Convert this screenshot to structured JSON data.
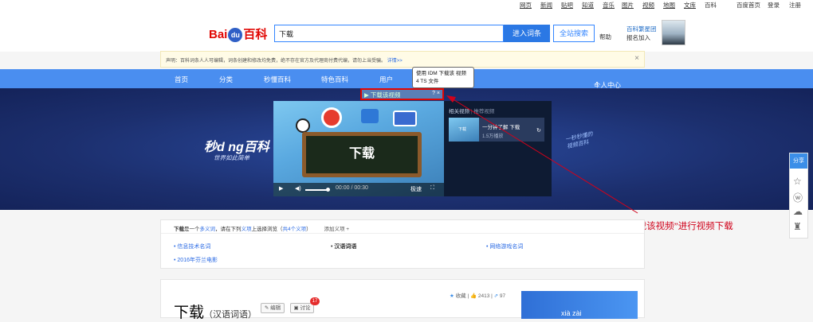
{
  "topnav": {
    "items": [
      "网页",
      "新闻",
      "贴吧",
      "知道",
      "音乐",
      "图片",
      "视频",
      "地图",
      "文库",
      "百科",
      "百度首页",
      "登录",
      "注册"
    ]
  },
  "header": {
    "logo_left": "Bai",
    "logo_paw": "du",
    "logo_right": "百科",
    "search_value": "下载",
    "enter_label": "进入词条",
    "fulltext_label": "全站搜索",
    "help_label": "帮助",
    "star_line1": "百科繁星团",
    "star_line2": "报名加入"
  },
  "notice": {
    "text": "声明：百科词条人人可编辑，词条创建和修改均免费，绝不存在官方及代理商付费代编，请勿上当受骗。",
    "link": "详情>>",
    "close": "×"
  },
  "mainnav": {
    "items": [
      "首页",
      "分类",
      "秒懂百科",
      "特色百科",
      "用户"
    ],
    "personal": "个人中心"
  },
  "banner": {
    "logo": "秒d ng百科",
    "slogan": "世界如此简单",
    "hand_note_1": "一秒秒懂的",
    "hand_note_2": "视频百科"
  },
  "download_bar": {
    "label": "▶ 下载该视频",
    "extra": "? ×"
  },
  "tooltip": {
    "line1": "使用 IDM 下载该 视频",
    "line2": "4 TS 文件"
  },
  "video": {
    "board_text": "下载",
    "time": "00:00 / 00:30",
    "quality": "极速",
    "play_icon": "▶",
    "volume_icon": "◀)",
    "fullscreen_icon": "⛶"
  },
  "related": {
    "tab_related": "相关视频",
    "tab_hot": "推荐视频",
    "item_title": "一分钟了解 下载",
    "item_views": "1.5万播放",
    "thumb_label": "下载"
  },
  "annotation": "点击“下载该视频”进行视频下载",
  "share": {
    "label": "分享"
  },
  "ambiguity": {
    "head_word": "下载",
    "head_mid": "是一个",
    "head_link1": "多义词",
    "head_text": "，请在下列",
    "head_link2": "义项",
    "head_text2": "上选择浏览（",
    "head_link3": "共4个义项",
    "head_text3": "）",
    "add_sense": "添加义项 +",
    "links": [
      "信息技术名词",
      "汉语词语",
      "网络游戏名词",
      "2016年芬兰电影"
    ]
  },
  "lemma": {
    "title": "下载",
    "subtitle": "（汉语词语）",
    "edit": "编辑",
    "discuss": "讨论",
    "discuss_count": "17",
    "collect": "收藏",
    "likes": "2413",
    "shares": "97",
    "album_text": "xià    zài"
  },
  "colors": {
    "nav_blue": "#4a8ef0",
    "brand_red": "#e10602",
    "annotation_red": "#d0021b"
  }
}
